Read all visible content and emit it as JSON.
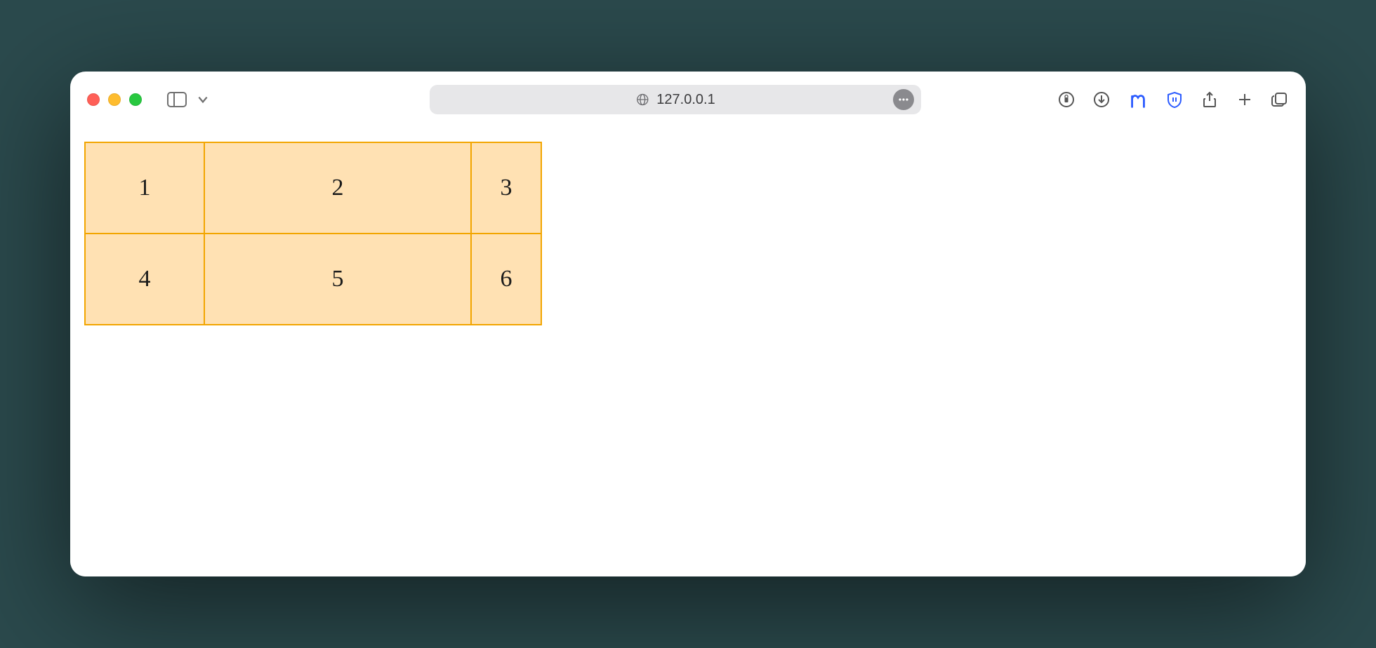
{
  "browser": {
    "address": "127.0.0.1"
  },
  "table": {
    "rows": [
      {
        "c1": "1",
        "c2": "2",
        "c3": "3"
      },
      {
        "c1": "4",
        "c2": "5",
        "c3": "6"
      }
    ]
  }
}
